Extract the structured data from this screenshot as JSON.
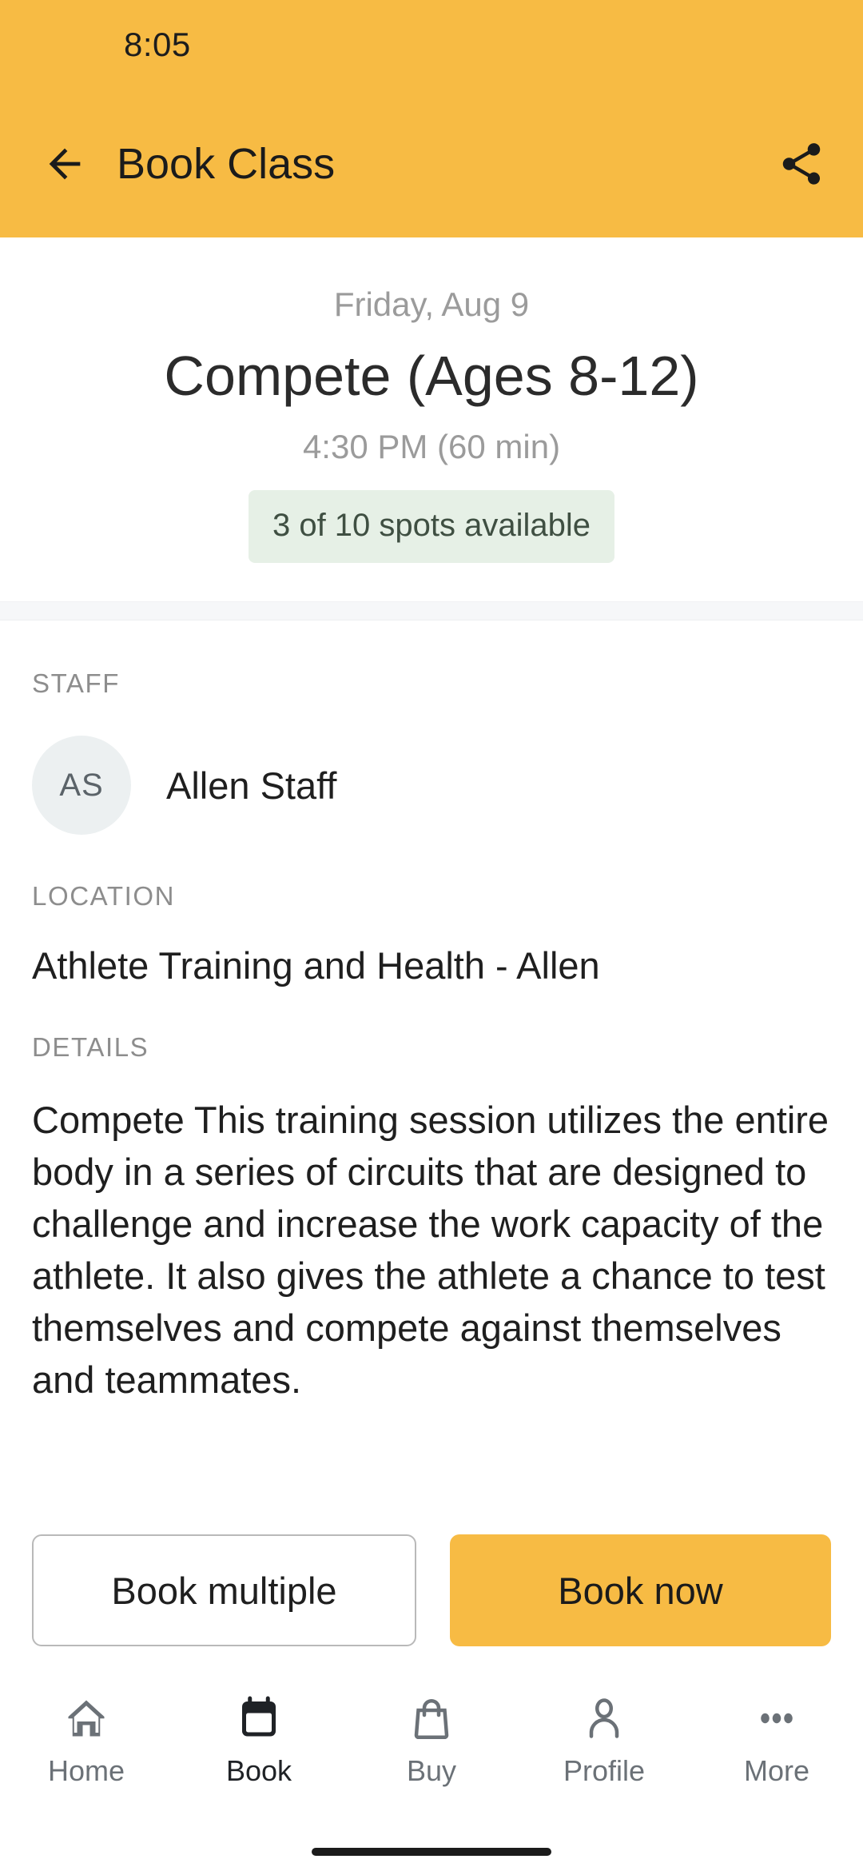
{
  "theme": {
    "accent": "#f7bb44",
    "badge_bg": "#e6f0e6",
    "badge_text": "#3f4f42",
    "avatar_bg": "#ecf0f1",
    "text_primary": "#1f1f1f",
    "text_muted": "#9b9b9b",
    "label_muted": "#8d8d8d",
    "nav_inactive": "#6b7177",
    "nav_active": "#1f2226"
  },
  "status_bar": {
    "time": "8:05"
  },
  "app_bar": {
    "title": "Book Class",
    "back_icon": "arrow-left-icon",
    "share_icon": "share-icon"
  },
  "hero": {
    "date": "Friday, Aug 9",
    "class_name": "Compete (Ages 8-12)",
    "time": "4:30 PM (60 min)",
    "spots_badge": "3 of 10 spots available"
  },
  "staff": {
    "label": "STAFF",
    "avatar_initials": "AS",
    "name": "Allen Staff"
  },
  "location": {
    "label": "LOCATION",
    "value": "Athlete Training and Health - Allen"
  },
  "details": {
    "label": "DETAILS",
    "text": "Compete This training session utilizes the entire body in a series of circuits that are designed to challenge and increase the work capacity of the athlete. It also gives the athlete a chance to test themselves and compete against themselves and teammates."
  },
  "actions": {
    "secondary_label": "Book multiple",
    "primary_label": "Book now"
  },
  "bottom_nav": {
    "items": [
      {
        "label": "Home",
        "icon": "home-icon",
        "active": false
      },
      {
        "label": "Book",
        "icon": "calendar-icon",
        "active": true
      },
      {
        "label": "Buy",
        "icon": "bag-icon",
        "active": false
      },
      {
        "label": "Profile",
        "icon": "person-icon",
        "active": false
      },
      {
        "label": "More",
        "icon": "dots-icon",
        "active": false
      }
    ]
  }
}
